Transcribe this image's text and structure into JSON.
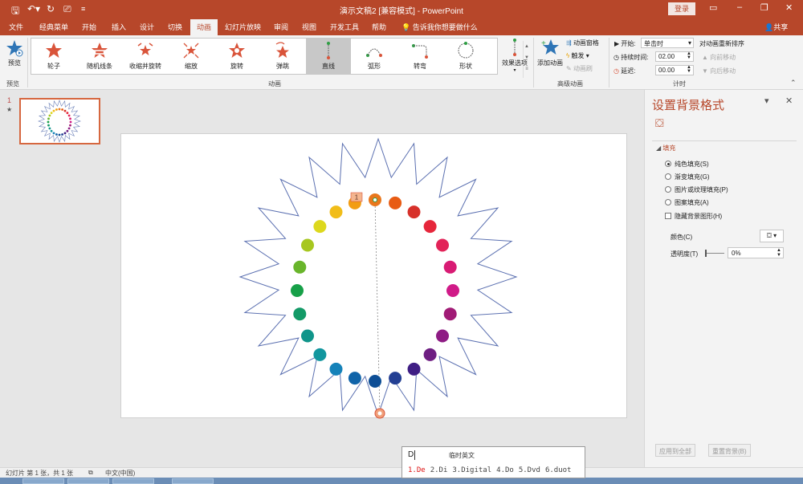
{
  "app": {
    "title": "演示文稿2 [兼容模式] - PowerPoint",
    "login": "登录"
  },
  "tabs": [
    "文件",
    "经典菜单",
    "开始",
    "插入",
    "设计",
    "切换",
    "动画",
    "幻灯片放映",
    "审阅",
    "视图",
    "开发工具",
    "帮助"
  ],
  "active_tab": "动画",
  "tell_me": "告诉我你想要做什么",
  "share": "共享",
  "ribbon": {
    "preview": {
      "label": "预览",
      "group": "预览"
    },
    "animations": {
      "group": "动画",
      "effects": [
        {
          "label": "轮子",
          "icon": "star-icon"
        },
        {
          "label": "随机线条",
          "icon": "random-bars-icon"
        },
        {
          "label": "收缩并旋转",
          "icon": "shrink-turn-icon"
        },
        {
          "label": "缩放",
          "icon": "zoom-icon"
        },
        {
          "label": "旋转",
          "icon": "spin-icon"
        },
        {
          "label": "弹跳",
          "icon": "bounce-icon"
        },
        {
          "label": "直线",
          "icon": "line-path-icon"
        },
        {
          "label": "弧形",
          "icon": "arc-path-icon"
        },
        {
          "label": "转弯",
          "icon": "turn-path-icon"
        },
        {
          "label": "形状",
          "icon": "shape-path-icon"
        }
      ],
      "active_effect": "直线",
      "effect_options": "效果选项"
    },
    "advanced": {
      "group": "高级动画",
      "add_animation": "添加动画",
      "pane": "动画窗格",
      "trigger": "触发",
      "painter": "动画刷"
    },
    "timing": {
      "group": "计时",
      "start_label": "开始:",
      "start_value": "单击时",
      "duration_label": "持续时间:",
      "duration_value": "02.00",
      "delay_label": "延迟:",
      "delay_value": "00.00",
      "reorder": "对动画重新排序",
      "move_earlier": "向前移动",
      "move_later": "向后移动"
    }
  },
  "thumbnails": {
    "slide_number": "1",
    "star": "★"
  },
  "slide": {
    "tag_number": "1",
    "dot_colors": [
      "#e9771d",
      "#e85c14",
      "#d7312a",
      "#e6263b",
      "#e22358",
      "#d81b74",
      "#d01a88",
      "#a11b76",
      "#8e1c84",
      "#6e1e82",
      "#3f1e84",
      "#233f93",
      "#0e4e95",
      "#1064a9",
      "#1582b9",
      "#11969e",
      "#10958a",
      "#139a67",
      "#17a048",
      "#69b52b",
      "#a7c71f",
      "#ddd81d",
      "#f1bd19",
      "#f29d14"
    ]
  },
  "format_pane": {
    "title": "设置背景格式",
    "section": "填充",
    "options": [
      {
        "label": "纯色填充(S)",
        "selected": true
      },
      {
        "label": "渐变填充(G)",
        "selected": false
      },
      {
        "label": "图片或纹理填充(P)",
        "selected": false
      },
      {
        "label": "图案填充(A)",
        "selected": false
      }
    ],
    "hide_bg": "隐藏背景图形(H)",
    "color_label": "颜色(C)",
    "transparency_label": "透明度(T)",
    "transparency_value": "0%",
    "apply_all": "应用到全部",
    "reset_bg": "重置背景(B)"
  },
  "status": {
    "slide_info": "幻灯片 第 1 张，共 1 张",
    "language": "中文(中国)"
  },
  "ime": {
    "input": "D",
    "mode": "临时英文",
    "candidates": [
      "1.De",
      "2.Di",
      "3.Digital",
      "4.Do",
      "5.Dvd",
      "6.duot"
    ]
  }
}
